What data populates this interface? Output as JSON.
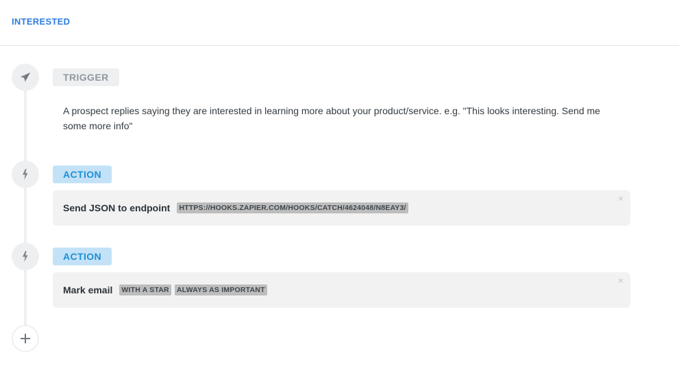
{
  "header": {
    "title": "INTERESTED"
  },
  "steps": [
    {
      "kind": "trigger",
      "tag": "TRIGGER",
      "icon": "paper-plane-icon",
      "description": "A prospect replies saying they are interested in learning more about your product/service. e.g. \"This looks interesting. Send me some more info\""
    },
    {
      "kind": "action",
      "tag": "ACTION",
      "icon": "lightning-bolt-icon",
      "title": "Send JSON to endpoint",
      "params": [
        "HTTPS://HOOKS.ZAPIER.COM/HOOKS/CATCH/4624048/N8EAY3/"
      ],
      "close": "×"
    },
    {
      "kind": "action",
      "tag": "ACTION",
      "icon": "lightning-bolt-icon",
      "title": "Mark email",
      "params": [
        "WITH A STAR",
        "ALWAYS AS IMPORTANT"
      ],
      "close": "×"
    }
  ],
  "add_step": {
    "icon": "plus-icon",
    "label": "+"
  },
  "colors": {
    "accent": "#2f7de1",
    "action_tag_bg": "#c3e2f7",
    "action_tag_text": "#1f8fd6",
    "trigger_tag_bg": "#eeeff1",
    "trigger_tag_text": "#8f979e",
    "card_bg": "#f2f2f2",
    "param_bg": "#bdbdbd"
  }
}
